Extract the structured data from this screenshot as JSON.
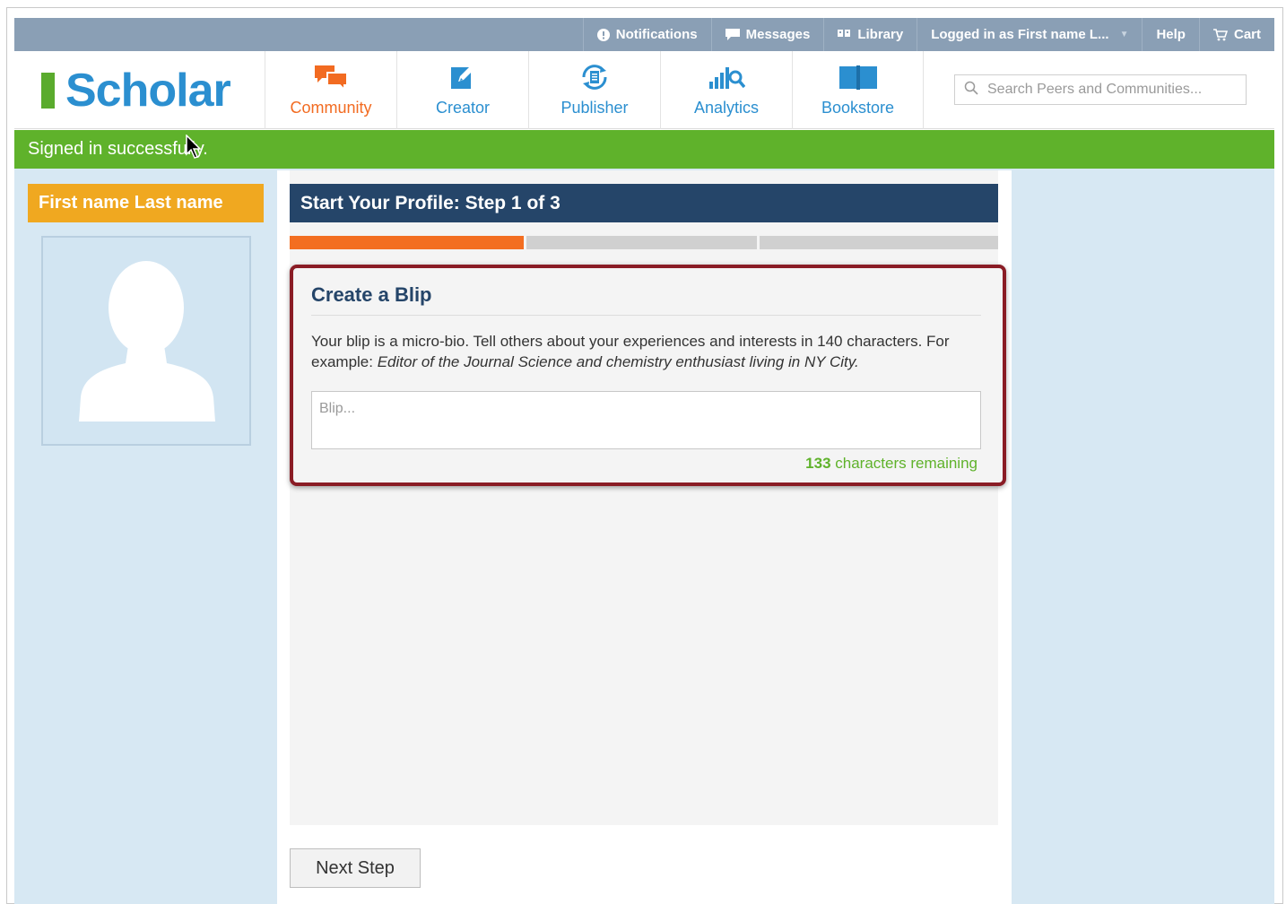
{
  "topbar": {
    "notifications": "Notifications",
    "messages": "Messages",
    "library": "Library",
    "logged_in": "Logged in as First name L...",
    "help": "Help",
    "cart": "Cart"
  },
  "logo": {
    "text": "Scholar"
  },
  "nav": {
    "items": [
      {
        "label": "Community",
        "icon": "chat-bubbles-icon"
      },
      {
        "label": "Creator",
        "icon": "pencil-icon"
      },
      {
        "label": "Publisher",
        "icon": "publish-cycle-icon"
      },
      {
        "label": "Analytics",
        "icon": "chart-magnifier-icon"
      },
      {
        "label": "Bookstore",
        "icon": "open-book-icon"
      }
    ],
    "active": "Community"
  },
  "search": {
    "placeholder": "Search Peers and Communities..."
  },
  "alert": {
    "message": "Signed in successfully."
  },
  "profile": {
    "name": "First name Last name"
  },
  "step": {
    "title": "Start Your Profile: Step 1 of 3",
    "current": 1,
    "total": 3
  },
  "blip": {
    "title": "Create a Blip",
    "description": "Your blip is a micro-bio. Tell others about your experiences and interests in 140 characters. For example: ",
    "example": "Editor of the Journal Science and chemistry enthusiast living in NY City.",
    "placeholder": "Blip...",
    "remaining_count": "133",
    "remaining_label": " characters remaining"
  },
  "buttons": {
    "next_step": "Next Step"
  },
  "colors": {
    "brand_blue": "#2b8fd0",
    "active_orange": "#f26b21",
    "success_green": "#5fb22b",
    "header_navy": "#254569",
    "name_badge": "#f0a820",
    "highlight_border": "#8a1c25"
  }
}
